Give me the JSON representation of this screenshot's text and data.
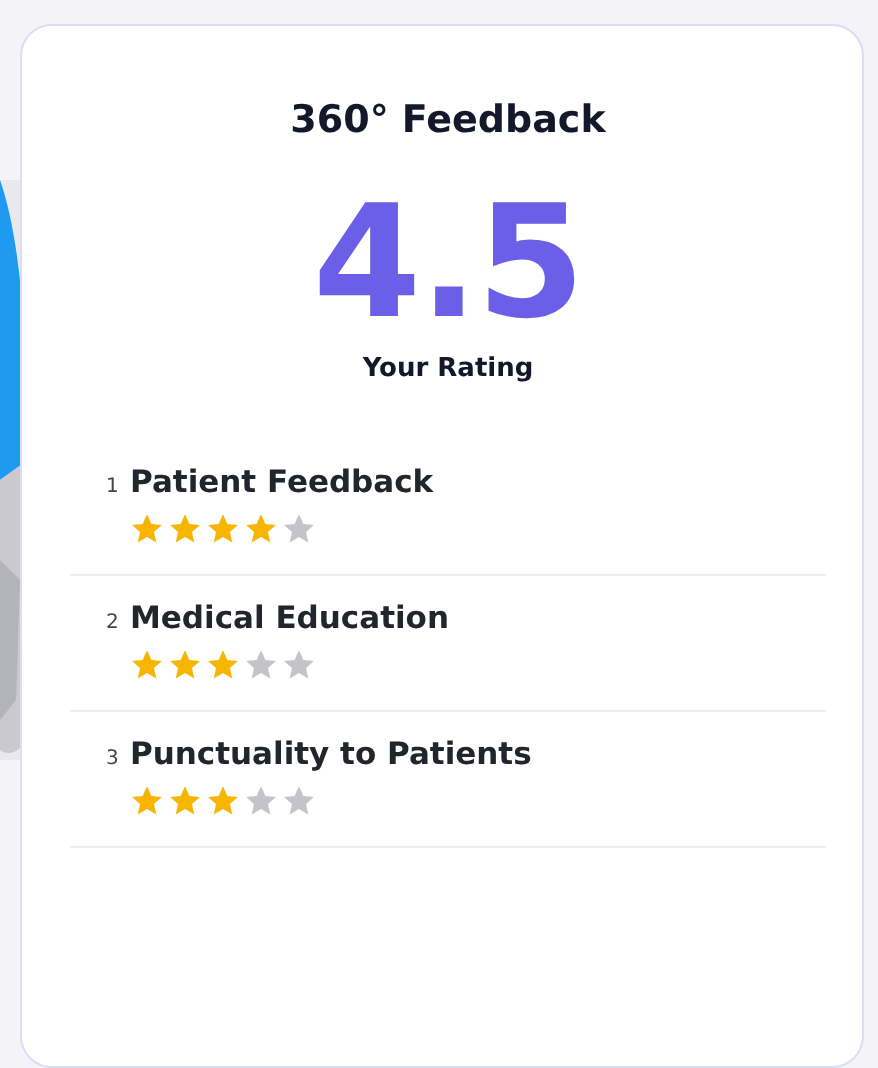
{
  "title": "360° Feedback",
  "score": "4.5",
  "score_label": "Your Rating",
  "criteria": [
    {
      "index": "1",
      "name": "Patient Feedback",
      "stars": 4
    },
    {
      "index": "2",
      "name": "Medical Education",
      "stars": 3
    },
    {
      "index": "3",
      "name": "Punctuality to Patients",
      "stars": 3
    }
  ]
}
